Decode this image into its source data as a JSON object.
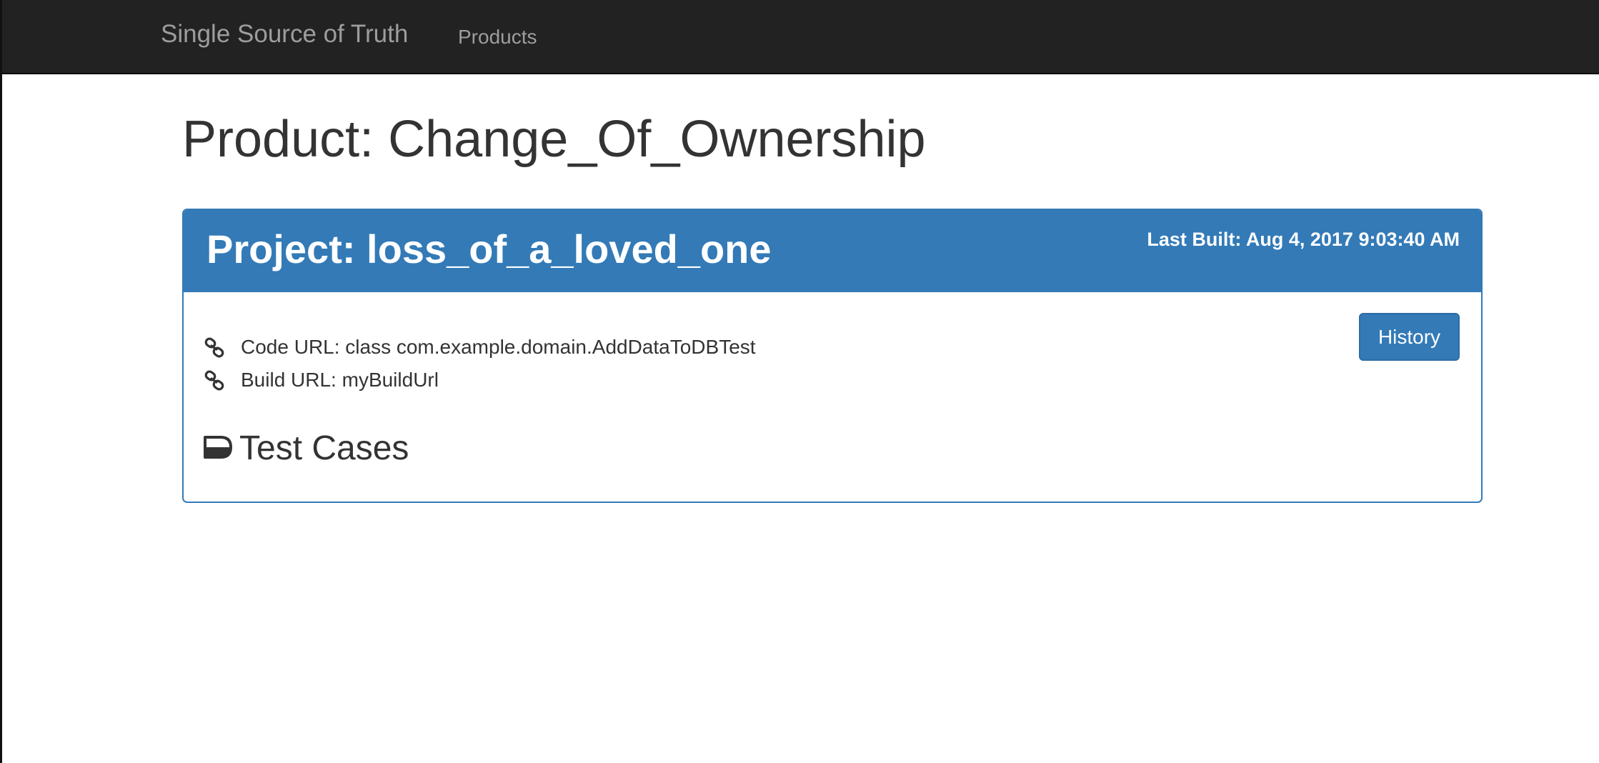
{
  "navbar": {
    "brand": "Single Source of Truth",
    "links": [
      "Products"
    ]
  },
  "page": {
    "title": "Product: Change_Of_Ownership"
  },
  "project": {
    "title": "Project: loss_of_a_loved_one",
    "last_built": "Last Built: Aug 4, 2017 9:03:40 AM",
    "history_label": "History",
    "code_url": "Code URL: class com.example.domain.AddDataToDBTest",
    "build_url": "Build URL: myBuildUrl",
    "test_cases_title": "Test Cases"
  },
  "icons": {
    "code_url": "link-icon",
    "build_url": "link-icon",
    "test_cases": "tag-icon"
  },
  "colors": {
    "navbar_bg": "#222222",
    "navbar_text": "#9d9d9d",
    "primary": "#337ab7",
    "text": "#333333"
  }
}
